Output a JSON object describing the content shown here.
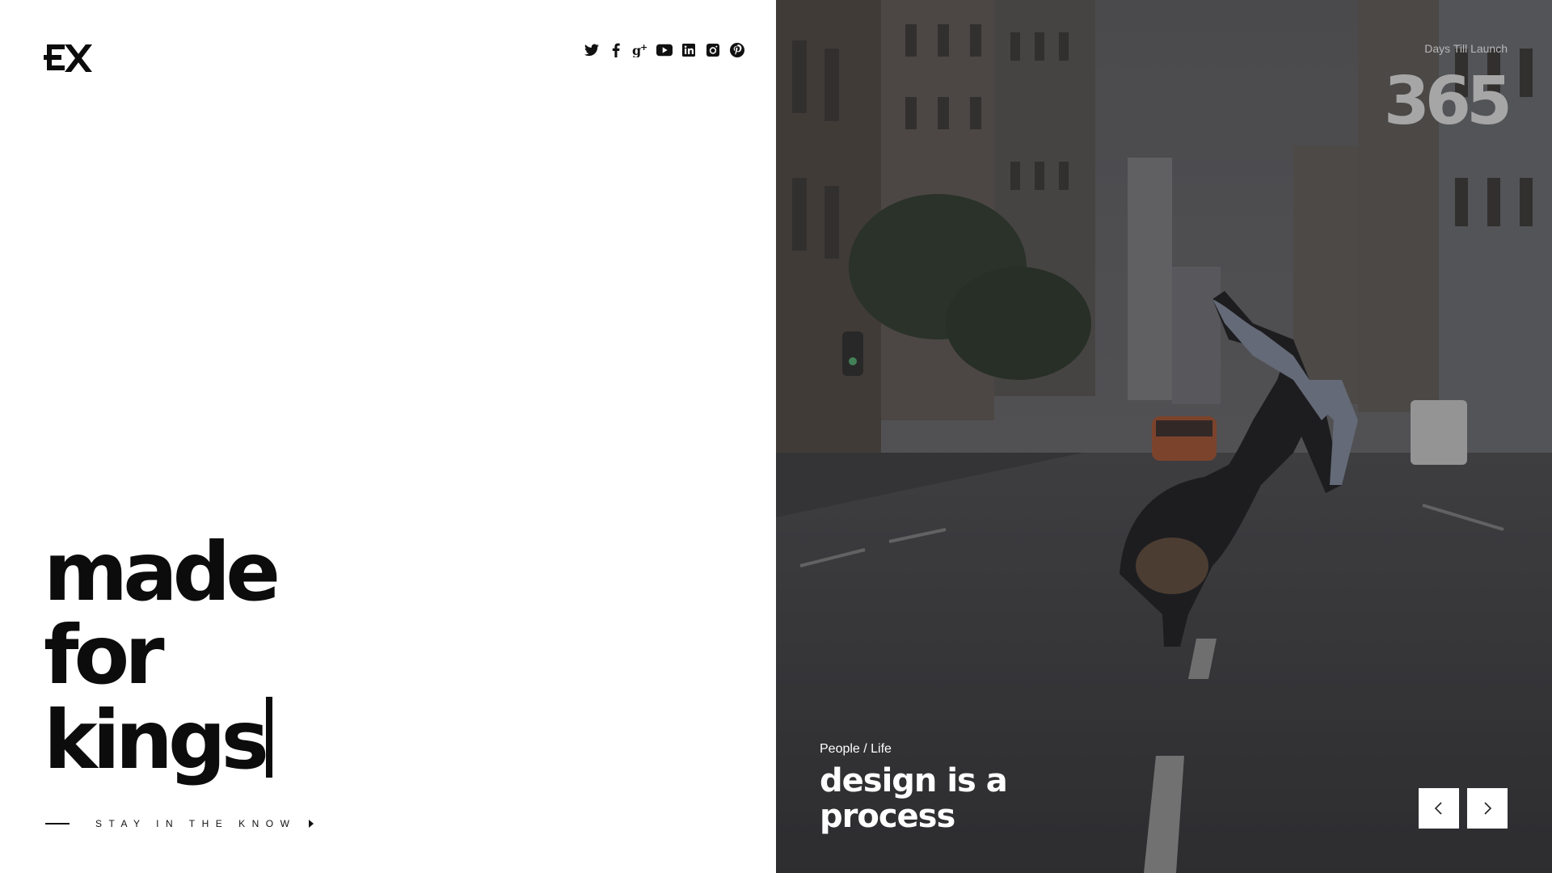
{
  "brand": {
    "logo_text": "EX"
  },
  "social": {
    "items": [
      {
        "name": "twitter-icon"
      },
      {
        "name": "facebook-icon"
      },
      {
        "name": "google-plus-icon"
      },
      {
        "name": "youtube-icon"
      },
      {
        "name": "linkedin-icon"
      },
      {
        "name": "instagram-icon"
      },
      {
        "name": "pinterest-icon"
      }
    ]
  },
  "hero": {
    "lines": [
      "made",
      "for",
      "kings"
    ]
  },
  "cta": {
    "label": "STAY IN THE KNOW"
  },
  "countdown": {
    "label": "Days Till Launch",
    "value": "365"
  },
  "slide": {
    "category": "People / Life",
    "title_line1": "design is a",
    "title_line2": "process"
  },
  "colors": {
    "text_dark": "#0c0c0c",
    "overlay": "#3f4043",
    "countdown_gray": "#a6a6a6"
  }
}
